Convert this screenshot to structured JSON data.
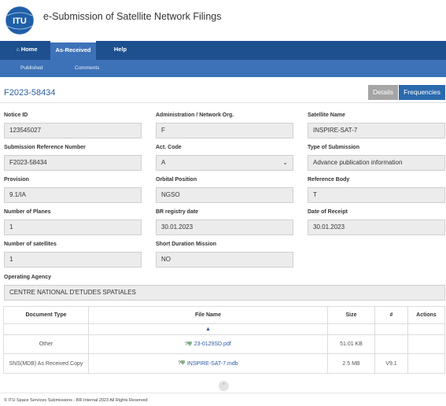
{
  "header": {
    "logo_text": "ITU",
    "title": "e-Submission of Satellite Network Filings"
  },
  "topnav": {
    "home": "Home",
    "as_received": "As-Received",
    "help": "Help"
  },
  "subnav": {
    "published": "Published",
    "comments": "Comments"
  },
  "record": {
    "id": "F2023-58434",
    "details_label": "Details",
    "frequencies_label": "Frequencies"
  },
  "form": {
    "notice_id": {
      "label": "Notice ID",
      "value": "123545027"
    },
    "administration": {
      "label": "Administration / Network Org.",
      "value": "F"
    },
    "satellite_name": {
      "label": "Satellite Name",
      "value": "INSPIRE-SAT-7"
    },
    "submission_ref": {
      "label": "Submission Reference Number",
      "value": "F2023-58434"
    },
    "act_code": {
      "label": "Act. Code",
      "value": "A"
    },
    "submission_type": {
      "label": "Type of Submission",
      "value": "Advance publication information"
    },
    "provision": {
      "label": "Provision",
      "value": "9.1/IA"
    },
    "orbital_position": {
      "label": "Orbital Position",
      "value": "NGSO"
    },
    "reference_body": {
      "label": "Reference Body",
      "value": "T"
    },
    "num_planes": {
      "label": "Number of Planes",
      "value": "1"
    },
    "br_registry_date": {
      "label": "BR registry date",
      "value": "30.01.2023"
    },
    "date_of_receipt": {
      "label": "Date of Receipt",
      "value": "30.01.2023"
    },
    "num_satellites": {
      "label": "Number of satellites",
      "value": "1"
    },
    "short_duration": {
      "label": "Short Duration Mission",
      "value": "NO"
    },
    "operating_agency": {
      "label": "Operating Agency",
      "value": "CENTRE NATIONAL D'ETUDES SPATIALES"
    }
  },
  "table": {
    "columns": {
      "doc_type": "Document Type",
      "file_name": "File Name",
      "size": "Size",
      "num": "#",
      "actions": "Actions"
    },
    "rows": [
      {
        "doc_type": "Other",
        "file_name": "23-0129SD.pdf",
        "size": "51.01 KB",
        "num": "",
        "actions": ""
      },
      {
        "doc_type": "SNS(MDB) As Received Copy",
        "file_name": "INSPIRE-SAT-7.mdb",
        "size": "2.5 MB",
        "num": "V9.1",
        "actions": ""
      }
    ]
  },
  "footer": {
    "text": "© ITU Space Services Submissions - BR Internal 2023 All Rights Reserved"
  },
  "colors": {
    "nav_dark": "#1e4f8f",
    "nav_light": "#3d72b8",
    "link": "#2a5ea3",
    "frequencies_button": "#2a6aad"
  }
}
